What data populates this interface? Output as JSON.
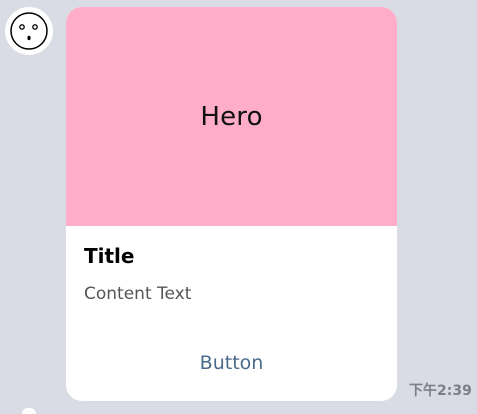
{
  "sender": {
    "avatar_icon": "face-icon"
  },
  "card": {
    "hero_text": "Hero",
    "hero_color": "#ffadc9",
    "title": "Title",
    "content": "Content Text",
    "button_label": "Button",
    "button_color": "#4a6a8c"
  },
  "message": {
    "time": "下午2:39"
  },
  "colors": {
    "chat_background": "#d9dce5",
    "bubble_background": "#ffffff"
  }
}
